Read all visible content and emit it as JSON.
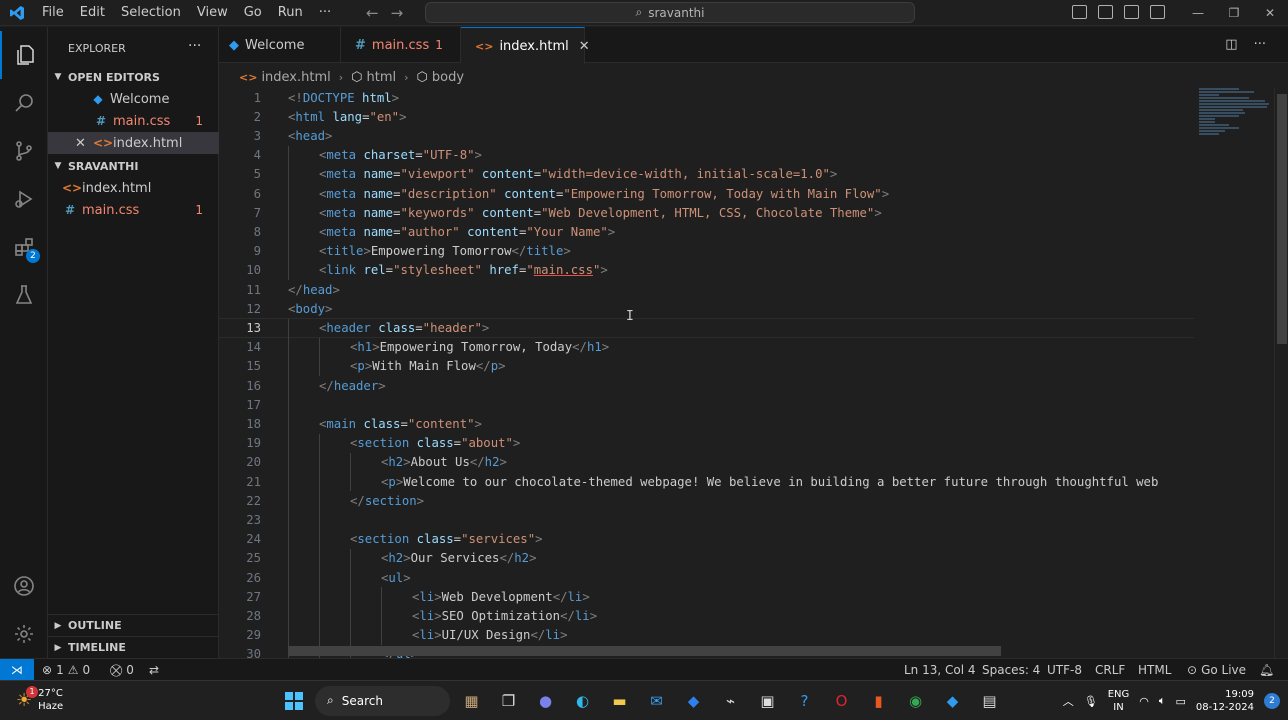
{
  "titlebar": {
    "menu": [
      "File",
      "Edit",
      "Selection",
      "View",
      "Go",
      "Run",
      "···"
    ],
    "search": "sravanthi"
  },
  "sidebar": {
    "title": "EXPLORER",
    "open_editors_label": "OPEN EDITORS",
    "open_editors": [
      {
        "name": "Welcome",
        "count": ""
      },
      {
        "name": "main.css",
        "count": "1"
      },
      {
        "name": "index.html",
        "count": ""
      }
    ],
    "folder_label": "SRAVANTHI",
    "folder_files": [
      {
        "name": "index.html",
        "count": ""
      },
      {
        "name": "main.css",
        "count": "1"
      }
    ],
    "outline_label": "OUTLINE",
    "timeline_label": "TIMELINE"
  },
  "activity": {
    "extensions_badge": "2"
  },
  "tabs": [
    {
      "label": "Welcome",
      "count": ""
    },
    {
      "label": "main.css",
      "count": "1"
    },
    {
      "label": "index.html",
      "count": ""
    }
  ],
  "breadcrumb": [
    "index.html",
    "html",
    "body"
  ],
  "editor": {
    "line_numbers": [
      "1",
      "2",
      "3",
      "4",
      "5",
      "6",
      "7",
      "8",
      "9",
      "10",
      "11",
      "12",
      "13",
      "14",
      "15",
      "16",
      "17",
      "18",
      "19",
      "20",
      "21",
      "22",
      "23",
      "24",
      "25",
      "26",
      "27",
      "28",
      "29",
      "30"
    ],
    "current_line": 13
  },
  "statusbar": {
    "errors": "1",
    "warnings": "0",
    "ports": "0",
    "position": "Ln 13, Col 4",
    "spaces": "Spaces: 4",
    "encoding": "UTF-8",
    "eol": "CRLF",
    "language": "HTML",
    "golive": "Go Live"
  },
  "taskbar": {
    "weather_temp": "27°C",
    "weather_desc": "Haze",
    "weather_badge": "1",
    "search": "Search",
    "lang_top": "ENG",
    "lang_bottom": "IN",
    "time": "19:09",
    "date": "08-12-2024",
    "notif_count": "2"
  },
  "colors": {
    "accent": "#0078d4",
    "error": "#f48771",
    "tag": "#569cd6",
    "attr": "#9cdcfe",
    "string": "#ce9178"
  }
}
